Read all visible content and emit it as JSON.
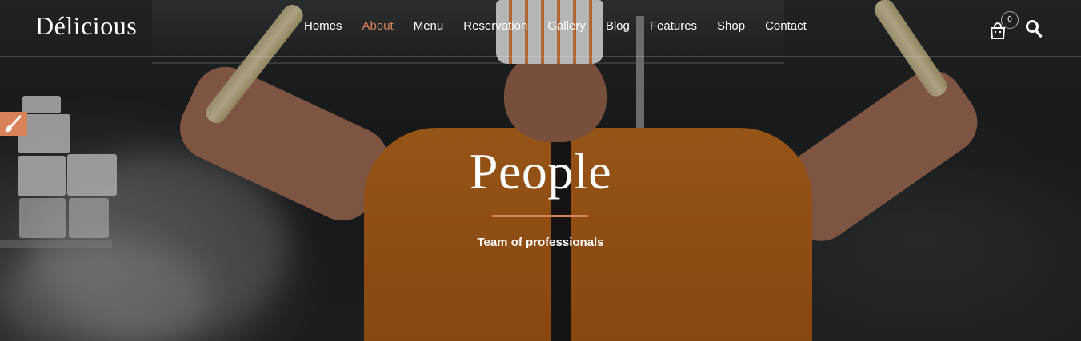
{
  "header": {
    "logo": "Délicious",
    "nav": [
      {
        "label": "Homes",
        "active": false
      },
      {
        "label": "About",
        "active": true
      },
      {
        "label": "Menu",
        "active": false
      },
      {
        "label": "Reservation",
        "active": false
      },
      {
        "label": "Gallery",
        "active": false
      },
      {
        "label": "Blog",
        "active": false
      },
      {
        "label": "Features",
        "active": false
      },
      {
        "label": "Shop",
        "active": false
      },
      {
        "label": "Contact",
        "active": false
      }
    ],
    "cart_count": "0",
    "icons": {
      "cart": "shopping-bag-icon",
      "search": "search-icon",
      "customizer": "paint-brush-icon"
    }
  },
  "hero": {
    "title": "People",
    "subtitle": "Team of professionals"
  },
  "colors": {
    "accent": "#d9825a",
    "text": "#ffffff"
  }
}
